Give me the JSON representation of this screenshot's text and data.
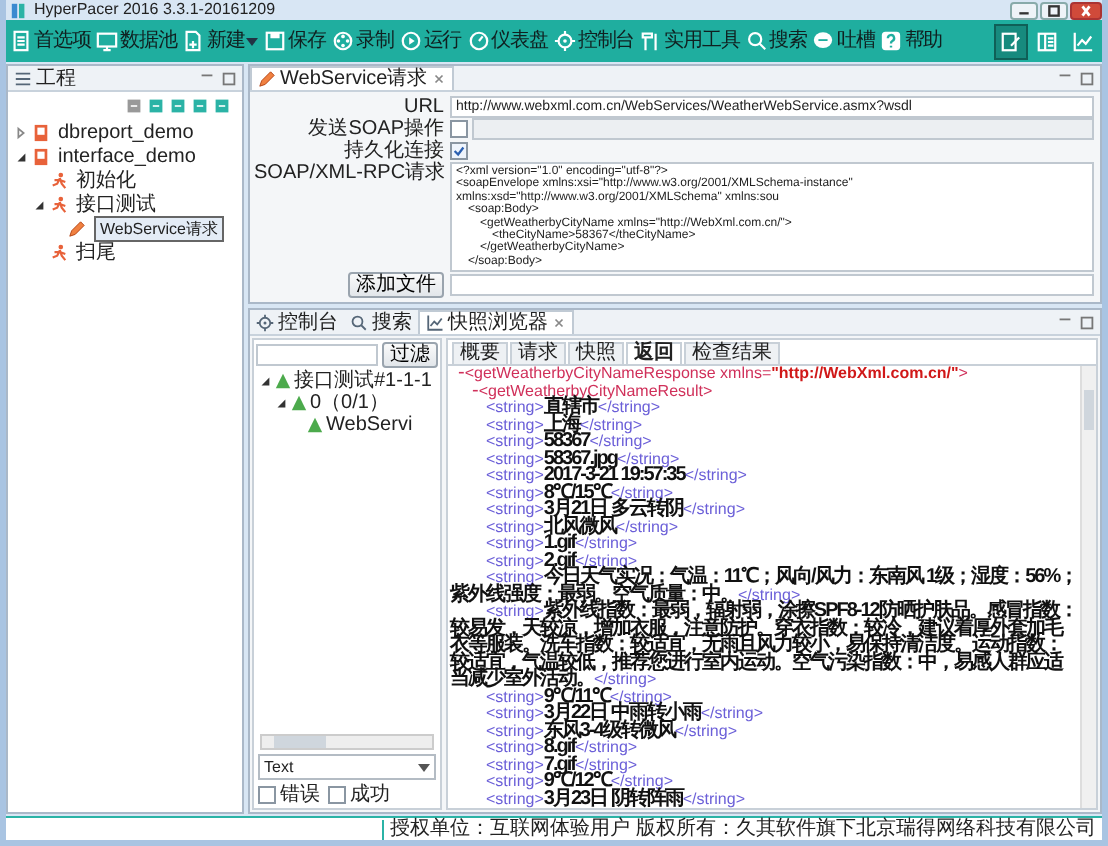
{
  "window": {
    "title": "HyperPacer  2016  3.3.1-20161209"
  },
  "toolbar": {
    "items": [
      {
        "label": "首选项",
        "kind": "button"
      },
      {
        "label": "数据池",
        "kind": "button"
      },
      {
        "label": "新建",
        "kind": "dropdown"
      },
      {
        "label": "保存",
        "kind": "button"
      },
      {
        "label": "录制",
        "kind": "button"
      },
      {
        "label": "运行",
        "kind": "button"
      },
      {
        "label": "仪表盘",
        "kind": "button"
      },
      {
        "label": "控制台",
        "kind": "button"
      },
      {
        "label": "实用工具",
        "kind": "button"
      },
      {
        "label": "搜索",
        "kind": "button"
      },
      {
        "label": "吐槽",
        "kind": "button"
      },
      {
        "label": "帮助",
        "kind": "button"
      }
    ],
    "view_buttons": [
      {
        "selected": true
      },
      {
        "selected": false
      },
      {
        "selected": false
      }
    ]
  },
  "project_panel": {
    "title": "工程",
    "tree": [
      {
        "label": "dbreport_demo",
        "kind": "project",
        "expanded": false,
        "selected": false
      },
      {
        "label": "interface_demo",
        "kind": "project",
        "expanded": true,
        "selected": false,
        "children": [
          {
            "label": "初始化",
            "kind": "group",
            "selected": false
          },
          {
            "label": "接口测试",
            "kind": "group",
            "expanded": true,
            "selected": false,
            "children": [
              {
                "label": "WebService请求",
                "kind": "request",
                "selected": true
              }
            ]
          },
          {
            "label": "扫尾",
            "kind": "group",
            "selected": false
          }
        ]
      }
    ]
  },
  "editor": {
    "tab": "WebService请求",
    "url_label": "URL",
    "url": "http://www.webxml.com.cn/WebServices/WeatherWebService.asmx?wsdl",
    "soap_label": "发送SOAP操作",
    "soap_checked": false,
    "persist_label": "持久化连接",
    "persist_checked": true,
    "request_label": "SOAP/XML-RPC请求",
    "request_lines": [
      {
        "text": "<?xml version=\"1.0\" encoding=\"utf-8\"?>"
      },
      {
        "text": "<soapEnvelope xmlns:xsi=\"http://www.w3.org/2001/XMLSchema-instance\" xmlns:xsd=\"http://www.w3.org/2001/XMLSchema\" xmlns:sou",
        "children": [
          {
            "text": "<soap:Body>",
            "children": [
              {
                "text": "<getWeatherbyCityName xmlns=\"http://WebXml.com.cn/\">",
                "children": [
                  {
                    "text": "<theCityName>58367</theCityName>"
                  }
                ]
              },
              {
                "text": "</getWeatherbyCityName>"
              }
            ]
          },
          {
            "text": "</soap:Body>"
          }
        ]
      }
    ],
    "attach_button": "添加文件"
  },
  "bottom_panel": {
    "tabs": [
      {
        "label": "控制台",
        "kind": "console",
        "selected": false
      },
      {
        "label": "搜索",
        "kind": "search",
        "selected": false
      },
      {
        "label": "快照浏览器",
        "kind": "snapshot",
        "selected": true
      }
    ],
    "filter_button": "过滤",
    "result_tree": [
      {
        "label": "接口测试#1-1-1",
        "expanded": true,
        "children": [
          {
            "label": "0（0/1）",
            "expanded": true,
            "children": [
              {
                "label": "WebServi"
              }
            ]
          }
        ]
      }
    ],
    "format": "Text",
    "filters": [
      {
        "label": "错误",
        "checked": false
      },
      {
        "label": "成功",
        "checked": false
      }
    ],
    "subtabs": [
      {
        "label": "概要",
        "selected": false
      },
      {
        "label": "请求",
        "selected": false
      },
      {
        "label": "快照",
        "selected": false
      },
      {
        "label": "返回",
        "selected": true
      },
      {
        "label": "检查结果",
        "selected": false
      }
    ],
    "xml_tree": [
      {
        "marker": "-",
        "open": "<getWeatherbyCityNameResponse",
        "attr_name": " xmlns=",
        "attr_value": "\"http://WebXml.com.cn/\"",
        "open_end": ">",
        "children": [
          {
            "marker": "-",
            "open": "<getWeatherbyCityNameResult>",
            "children": [
              {
                "open": "<string>",
                "value": "直辖市",
                "close": "</string>"
              },
              {
                "open": "<string>",
                "value": "上海",
                "close": "</string>"
              },
              {
                "open": "<string>",
                "value": "58367",
                "close": "</string>"
              },
              {
                "open": "<string>",
                "value": "58367.jpg",
                "close": "</string>"
              },
              {
                "open": "<string>",
                "value": "2017-3-21 19:57:35",
                "close": "</string>"
              },
              {
                "open": "<string>",
                "value": "8℃/15℃",
                "close": "</string>"
              },
              {
                "open": "<string>",
                "value": "3月21日 多云转阴",
                "close": "</string>"
              },
              {
                "open": "<string>",
                "value": "北风微风",
                "close": "</string>"
              },
              {
                "open": "<string>",
                "value": "1.gif",
                "close": "</string>"
              },
              {
                "open": "<string>",
                "value": "2.gif",
                "close": "</string>"
              },
              {
                "open": "<string>",
                "value": "今日天气实况：气温：11℃；风向/风力：东南风 1级；湿度：56%；紫外线强度：最弱。空气质量：中。",
                "close": "</string>"
              },
              {
                "open": "<string>",
                "value": "紫外线指数：最弱，辐射弱，涂擦SPF8-12防晒护肤品。感冒指数：较易发，天较凉，增加衣服，注意防护。穿衣指数：较冷，建议着厚外套加毛衣等服装。洗车指数：较适宜，无雨且风力较小，易保持清洁度。运动指数：较适宜，气温较低，推荐您进行室内运动。空气污染指数：中，易感人群应适当减少室外活动。",
                "close": "</string>"
              },
              {
                "open": "<string>",
                "value": "9℃/11℃",
                "close": "</string>"
              },
              {
                "open": "<string>",
                "value": "3月22日 中雨转小雨",
                "close": "</string>"
              },
              {
                "open": "<string>",
                "value": "东风3-4级转微风",
                "close": "</string>"
              },
              {
                "open": "<string>",
                "value": "8.gif",
                "close": "</string>"
              },
              {
                "open": "<string>",
                "value": "7.gif",
                "close": "</string>"
              },
              {
                "open": "<string>",
                "value": "9℃/12℃",
                "close": "</string>"
              },
              {
                "open": "<string>",
                "value": "3月23日 阴转阵雨",
                "close": "</string>"
              }
            ]
          }
        ]
      }
    ]
  },
  "status_bar": "授权单位：互联网体验用户 版权所有：久其软件旗下北京瑞得网络科技有限公司"
}
